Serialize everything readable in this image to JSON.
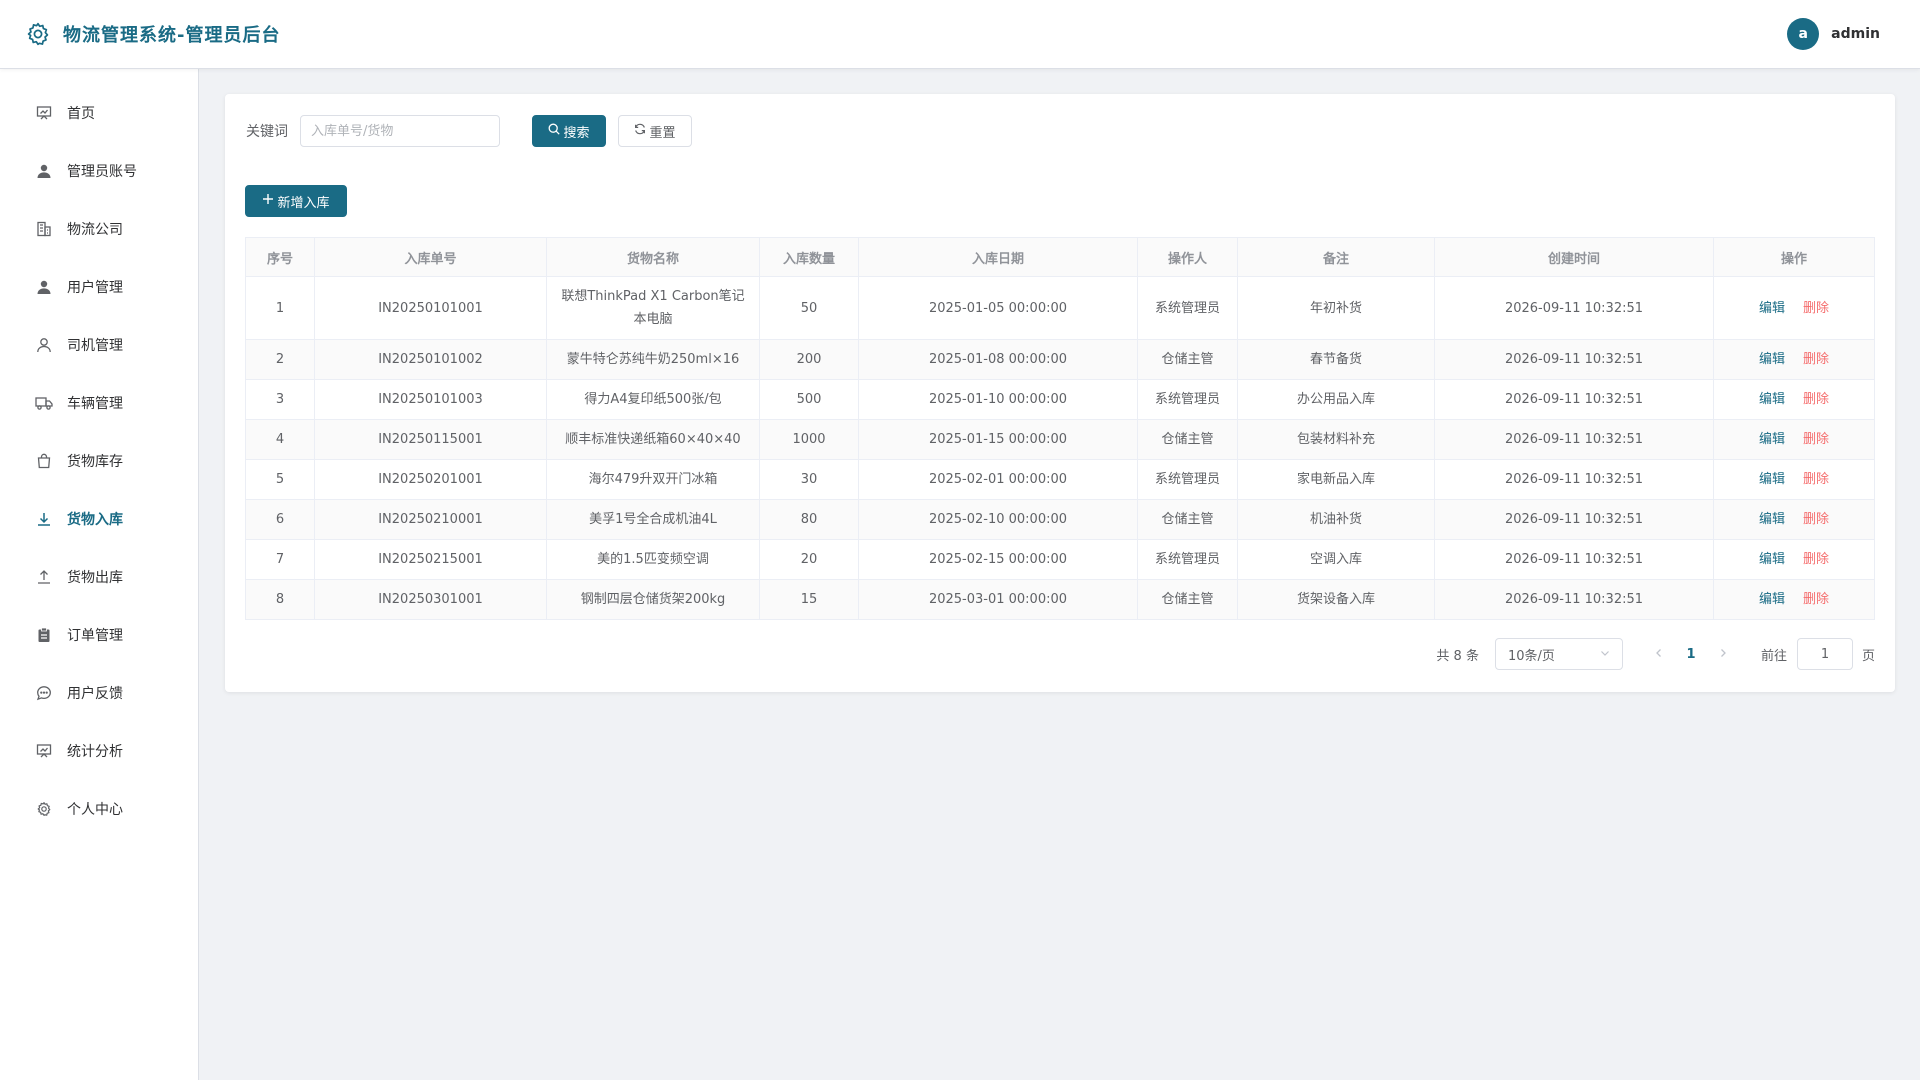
{
  "header": {
    "title": "物流管理系统-管理员后台",
    "avatar_letter": "a",
    "username": "admin",
    "accent": "#1a6b85"
  },
  "sidebar": {
    "items": [
      {
        "label": "首页",
        "icon": "dashboard-icon"
      },
      {
        "label": "管理员账号",
        "icon": "user-filled-icon"
      },
      {
        "label": "物流公司",
        "icon": "office-building-icon"
      },
      {
        "label": "用户管理",
        "icon": "user-filled-icon"
      },
      {
        "label": "司机管理",
        "icon": "user-outline-icon"
      },
      {
        "label": "车辆管理",
        "icon": "truck-icon"
      },
      {
        "label": "货物库存",
        "icon": "shopping-bag-icon"
      },
      {
        "label": "货物入库",
        "icon": "download-icon",
        "active": true
      },
      {
        "label": "货物出库",
        "icon": "upload-icon"
      },
      {
        "label": "订单管理",
        "icon": "clipboard-icon"
      },
      {
        "label": "用户反馈",
        "icon": "chat-icon"
      },
      {
        "label": "统计分析",
        "icon": "chart-icon"
      },
      {
        "label": "个人中心",
        "icon": "gear-icon"
      }
    ]
  },
  "search": {
    "label": "关键词",
    "placeholder": "入库单号/货物",
    "value": "",
    "search_button": "搜索",
    "reset_button": "重置"
  },
  "add_button": "新增入库",
  "table": {
    "headers": [
      "序号",
      "入库单号",
      "货物名称",
      "入库数量",
      "入库日期",
      "操作人",
      "备注",
      "创建时间",
      "操作"
    ],
    "edit_label": "编辑",
    "delete_label": "删除",
    "rows": [
      {
        "index": "1",
        "order_no": "IN20250101001",
        "goods": "联想ThinkPad X1 Carbon笔记本电脑",
        "qty": "50",
        "date": "2025-01-05 00:00:00",
        "operator": "系统管理员",
        "remark": "年初补货",
        "created": "2026-09-11 10:32:51"
      },
      {
        "index": "2",
        "order_no": "IN20250101002",
        "goods": "蒙牛特仑苏纯牛奶250ml×16",
        "qty": "200",
        "date": "2025-01-08 00:00:00",
        "operator": "仓储主管",
        "remark": "春节备货",
        "created": "2026-09-11 10:32:51"
      },
      {
        "index": "3",
        "order_no": "IN20250101003",
        "goods": "得力A4复印纸500张/包",
        "qty": "500",
        "date": "2025-01-10 00:00:00",
        "operator": "系统管理员",
        "remark": "办公用品入库",
        "created": "2026-09-11 10:32:51"
      },
      {
        "index": "4",
        "order_no": "IN20250115001",
        "goods": "顺丰标准快递纸箱60×40×40",
        "qty": "1000",
        "date": "2025-01-15 00:00:00",
        "operator": "仓储主管",
        "remark": "包装材料补充",
        "created": "2026-09-11 10:32:51"
      },
      {
        "index": "5",
        "order_no": "IN20250201001",
        "goods": "海尔479升双开门冰箱",
        "qty": "30",
        "date": "2025-02-01 00:00:00",
        "operator": "系统管理员",
        "remark": "家电新品入库",
        "created": "2026-09-11 10:32:51"
      },
      {
        "index": "6",
        "order_no": "IN20250210001",
        "goods": "美孚1号全合成机油4L",
        "qty": "80",
        "date": "2025-02-10 00:00:00",
        "operator": "仓储主管",
        "remark": "机油补货",
        "created": "2026-09-11 10:32:51"
      },
      {
        "index": "7",
        "order_no": "IN20250215001",
        "goods": "美的1.5匹变频空调",
        "qty": "20",
        "date": "2025-02-15 00:00:00",
        "operator": "系统管理员",
        "remark": "空调入库",
        "created": "2026-09-11 10:32:51"
      },
      {
        "index": "8",
        "order_no": "IN20250301001",
        "goods": "钢制四层仓储货架200kg",
        "qty": "15",
        "date": "2025-03-01 00:00:00",
        "operator": "仓储主管",
        "remark": "货架设备入库",
        "created": "2026-09-11 10:32:51"
      }
    ]
  },
  "pagination": {
    "total_text": "共 8 条",
    "page_size": "10条/页",
    "current_page": "1",
    "goto_label": "前往",
    "goto_value": "1",
    "page_suffix": "页"
  }
}
